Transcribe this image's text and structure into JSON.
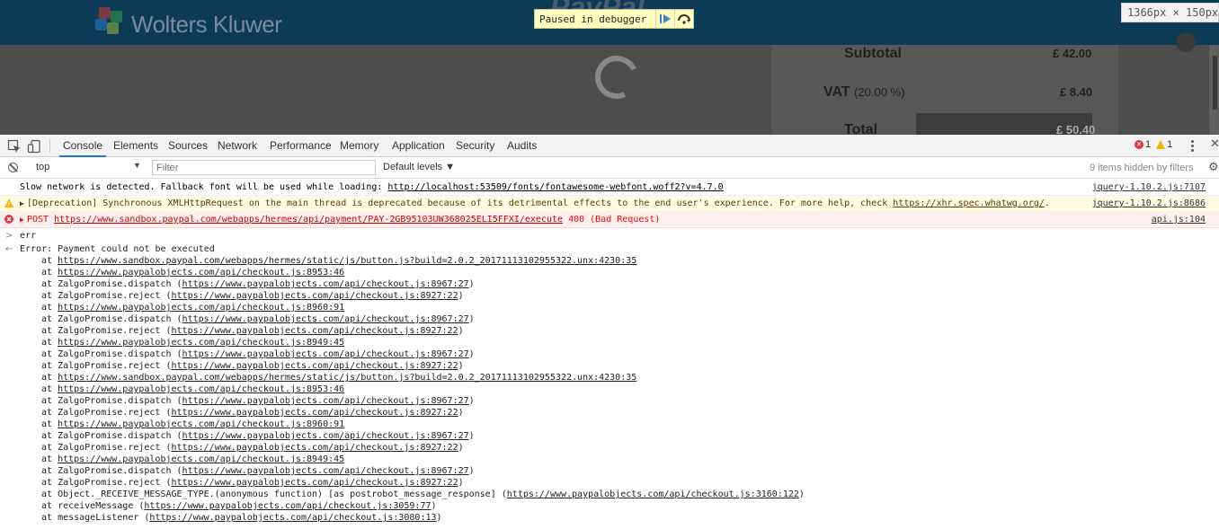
{
  "page": {
    "brand": "Wolters Kluwer",
    "paypal_partial": "PayPal",
    "summary": {
      "subtotal_label": "Subtotal",
      "subtotal_value": "£ 42.00",
      "vat_label": "VAT",
      "vat_rate": "(20.00 %)",
      "vat_value": "£ 8.40",
      "total_label": "Total",
      "total_value": "£ 50.40"
    },
    "paused_text": "Paused in debugger",
    "dimensions": "1366px × 150px"
  },
  "devtools": {
    "tabs": [
      "Console",
      "Elements",
      "Sources",
      "Network",
      "Performance",
      "Memory",
      "Application",
      "Security",
      "Audits"
    ],
    "error_count": "1",
    "warning_count": "1",
    "context": "top",
    "filter_placeholder": "Filter",
    "levels": "Default levels ▼",
    "hidden_note": "9 items hidden by filters"
  },
  "messages": [
    {
      "level": "info",
      "prefix": "Slow network is detected. Fallback font will be used while loading: ",
      "link": "http://localhost:53509/fonts/fontawesome-webfont.woff2?v=4.7.0",
      "suffix": "",
      "source": "jquery-1.10.2.js:7107"
    },
    {
      "level": "warn",
      "prefix": "[Deprecation] Synchronous XMLHttpRequest on the main thread is deprecated because of its detrimental effects to the end user's experience. For more help, check ",
      "link": "https://xhr.spec.whatwg.org/",
      "suffix": ".",
      "source": "jquery-1.10.2.js:8686"
    },
    {
      "level": "error",
      "prefix": "POST ",
      "link": "https://www.sandbox.paypal.com/webapps/hermes/api/payment/PAY-2GB95103UW368025ELI5FFXI/execute",
      "suffix": " 400 (Bad Request)",
      "source": "api.js:104"
    }
  ],
  "console_input": "err",
  "error_header": "Error: Payment could not be executed",
  "stack": [
    {
      "prefix": "at ",
      "fn": "",
      "link": "https://www.sandbox.paypal.com/webapps/hermes/static/js/button.js?build=2.0.2_20171113102955322.unx:4230:35",
      "paren": false
    },
    {
      "prefix": "at ",
      "fn": "",
      "link": "https://www.paypalobjects.com/api/checkout.js:8953:46",
      "paren": false
    },
    {
      "prefix": "at ",
      "fn": "ZalgoPromise.dispatch ",
      "link": "https://www.paypalobjects.com/api/checkout.js:8967:27",
      "paren": true
    },
    {
      "prefix": "at ",
      "fn": "ZalgoPromise.reject ",
      "link": "https://www.paypalobjects.com/api/checkout.js:8927:22",
      "paren": true
    },
    {
      "prefix": "at ",
      "fn": "",
      "link": "https://www.paypalobjects.com/api/checkout.js:8960:91",
      "paren": false
    },
    {
      "prefix": "at ",
      "fn": "ZalgoPromise.dispatch ",
      "link": "https://www.paypalobjects.com/api/checkout.js:8967:27",
      "paren": true
    },
    {
      "prefix": "at ",
      "fn": "ZalgoPromise.reject ",
      "link": "https://www.paypalobjects.com/api/checkout.js:8927:22",
      "paren": true
    },
    {
      "prefix": "at ",
      "fn": "",
      "link": "https://www.paypalobjects.com/api/checkout.js:8949:45",
      "paren": false
    },
    {
      "prefix": "at ",
      "fn": "ZalgoPromise.dispatch ",
      "link": "https://www.paypalobjects.com/api/checkout.js:8967:27",
      "paren": true
    },
    {
      "prefix": "at ",
      "fn": "ZalgoPromise.reject ",
      "link": "https://www.paypalobjects.com/api/checkout.js:8927:22",
      "paren": true
    },
    {
      "prefix": "at ",
      "fn": "",
      "link": "https://www.sandbox.paypal.com/webapps/hermes/static/js/button.js?build=2.0.2_20171113102955322.unx:4230:35",
      "paren": false
    },
    {
      "prefix": "at ",
      "fn": "",
      "link": "https://www.paypalobjects.com/api/checkout.js:8953:46",
      "paren": false
    },
    {
      "prefix": "at ",
      "fn": "ZalgoPromise.dispatch ",
      "link": "https://www.paypalobjects.com/api/checkout.js:8967:27",
      "paren": true
    },
    {
      "prefix": "at ",
      "fn": "ZalgoPromise.reject ",
      "link": "https://www.paypalobjects.com/api/checkout.js:8927:22",
      "paren": true
    },
    {
      "prefix": "at ",
      "fn": "",
      "link": "https://www.paypalobjects.com/api/checkout.js:8960:91",
      "paren": false
    },
    {
      "prefix": "at ",
      "fn": "ZalgoPromise.dispatch ",
      "link": "https://www.paypalobjects.com/api/checkout.js:8967:27",
      "paren": true
    },
    {
      "prefix": "at ",
      "fn": "ZalgoPromise.reject ",
      "link": "https://www.paypalobjects.com/api/checkout.js:8927:22",
      "paren": true
    },
    {
      "prefix": "at ",
      "fn": "",
      "link": "https://www.paypalobjects.com/api/checkout.js:8949:45",
      "paren": false
    },
    {
      "prefix": "at ",
      "fn": "ZalgoPromise.dispatch ",
      "link": "https://www.paypalobjects.com/api/checkout.js:8967:27",
      "paren": true
    },
    {
      "prefix": "at ",
      "fn": "ZalgoPromise.reject ",
      "link": "https://www.paypalobjects.com/api/checkout.js:8927:22",
      "paren": true
    },
    {
      "prefix": "at ",
      "fn": "Object._RECEIVE_MESSAGE_TYPE.(anonymous function) [as postrobot_message_response] ",
      "link": "https://www.paypalobjects.com/api/checkout.js:3160:122",
      "paren": true
    },
    {
      "prefix": "at ",
      "fn": "receiveMessage ",
      "link": "https://www.paypalobjects.com/api/checkout.js:3059:77",
      "paren": true
    },
    {
      "prefix": "at ",
      "fn": "messageListener ",
      "link": "https://www.paypalobjects.com/api/checkout.js:3080:13",
      "paren": true
    }
  ],
  "colors": {
    "error": "#e0383e",
    "warning": "#f4b400",
    "active_tab": "#1a73e8",
    "header_bar": "#0d3a55"
  }
}
